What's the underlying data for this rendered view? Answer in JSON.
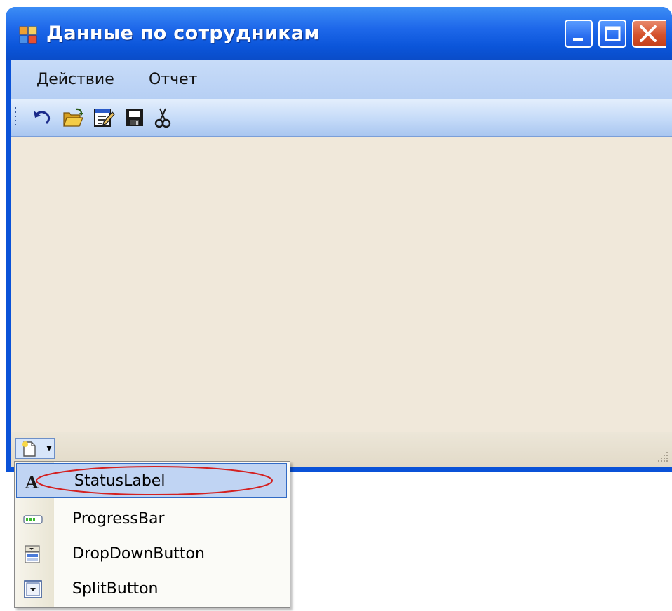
{
  "window": {
    "title": "Данные по сотрудникам"
  },
  "menubar": {
    "items": [
      "Действие",
      "Отчет"
    ]
  },
  "toolbar": {
    "icons": [
      "undo-icon",
      "open-folder-icon",
      "edit-form-icon",
      "save-icon",
      "cut-icon"
    ]
  },
  "statusbar": {
    "add_button_icon": "new-item-icon",
    "dropdown_arrow": "▾"
  },
  "dropdown": {
    "items": [
      {
        "label": "StatusLabel",
        "icon": "status-label-icon",
        "highlighted": true
      },
      {
        "label": "ProgressBar",
        "icon": "progress-bar-icon"
      },
      {
        "label": "DropDownButton",
        "icon": "dropdown-button-icon"
      },
      {
        "label": "SplitButton",
        "icon": "split-button-icon"
      }
    ]
  },
  "colors": {
    "titlebar": "#0a52d8",
    "highlight": "#c0d4f3",
    "annotation_ellipse": "#d42020"
  }
}
